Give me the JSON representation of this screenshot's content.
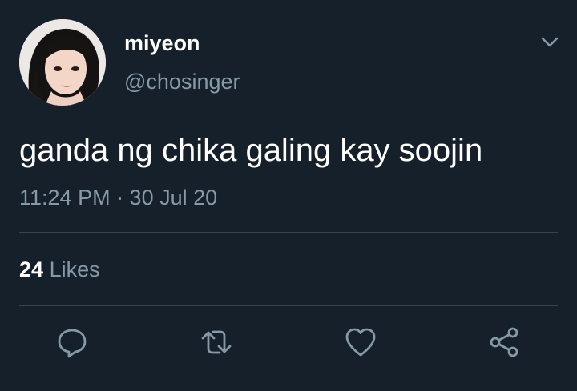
{
  "user": {
    "display_name": "miyeon",
    "handle": "@chosinger"
  },
  "tweet": {
    "text": "ganda ng chika galing kay soojin",
    "timestamp": "11:24 PM · 30 Jul 20"
  },
  "stats": {
    "likes_count": "24",
    "likes_label": "Likes"
  },
  "actions": {
    "icons": [
      "reply-icon",
      "retweet-icon",
      "like-icon",
      "share-icon"
    ]
  },
  "colors": {
    "background": "#15202b",
    "primary_text": "#ffffff",
    "secondary_text": "#8899a6",
    "divider": "#38444d"
  }
}
